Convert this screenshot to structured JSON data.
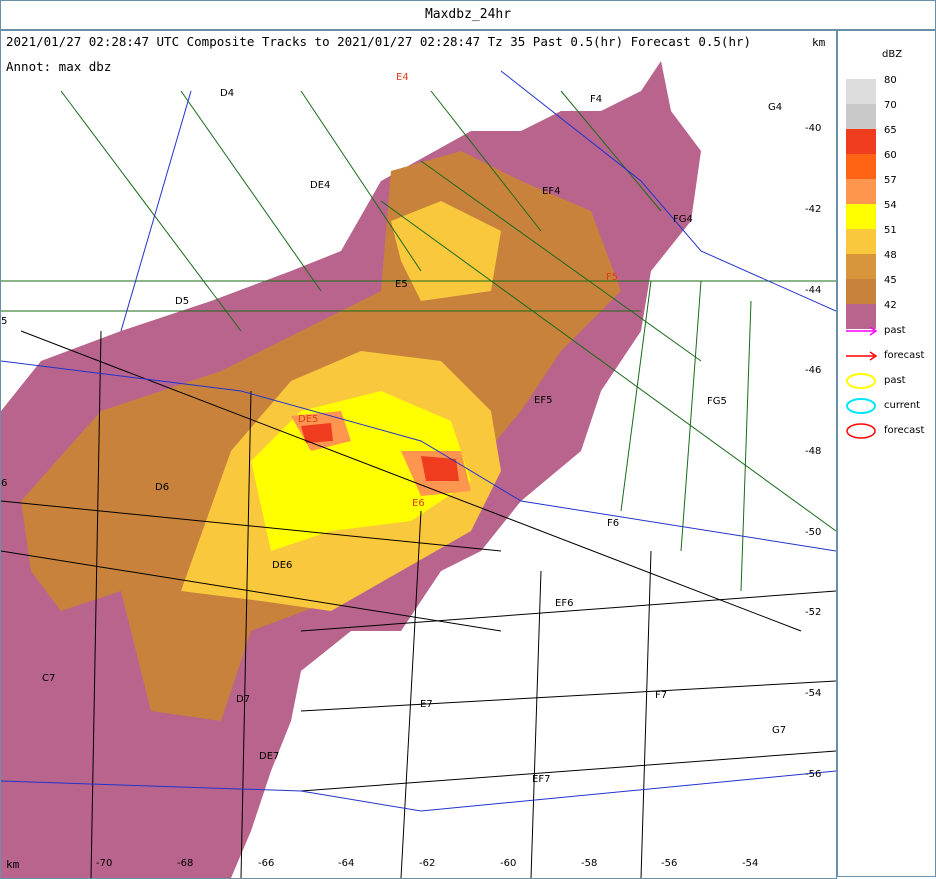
{
  "window": {
    "title": "Maxdbz_24hr"
  },
  "header": {
    "text": "2021/01/27 02:28:47 UTC Composite Tracks to 2021/01/27 02:28:47 Tz 35 Past 0.5(hr) Forecast 0.5(hr)",
    "unit_right": "km",
    "annot": "Annot: max dbz",
    "unit_bottom": "km"
  },
  "axes": {
    "x_ticks": [
      "-70",
      "-68",
      "-66",
      "-64",
      "-62",
      "-60",
      "-58",
      "-56",
      "-54"
    ],
    "y_ticks": [
      "-40",
      "-42",
      "-44",
      "-46",
      "-48",
      "-50",
      "-52",
      "-54",
      "-56"
    ]
  },
  "places": [
    {
      "label": "E4",
      "color": "red"
    },
    {
      "label": "D4",
      "color": "black"
    },
    {
      "label": "F4",
      "color": "black"
    },
    {
      "label": "G4",
      "color": "black"
    },
    {
      "label": "DE4",
      "color": "black"
    },
    {
      "label": "EF4",
      "color": "black"
    },
    {
      "label": "FG4",
      "color": "black"
    },
    {
      "label": "D5",
      "color": "black"
    },
    {
      "label": "E5",
      "color": "black"
    },
    {
      "label": "F5",
      "color": "red"
    },
    {
      "label": "EF5",
      "color": "black"
    },
    {
      "label": "FG5",
      "color": "black"
    },
    {
      "label": "DE5",
      "color": "red"
    },
    {
      "label": "D6",
      "color": "black"
    },
    {
      "label": "E6",
      "color": "red"
    },
    {
      "label": "F6",
      "color": "black"
    },
    {
      "label": "DE6",
      "color": "black"
    },
    {
      "label": "EF6",
      "color": "black"
    },
    {
      "label": "C7",
      "color": "black"
    },
    {
      "label": "D7",
      "color": "black"
    },
    {
      "label": "E7",
      "color": "black"
    },
    {
      "label": "F7",
      "color": "black"
    },
    {
      "label": "G7",
      "color": "black"
    },
    {
      "label": "DE7",
      "color": "black"
    },
    {
      "label": "EF7",
      "color": "black"
    },
    {
      "label": "5",
      "color": "black"
    },
    {
      "label": "6",
      "color": "black"
    }
  ],
  "legend": {
    "unit": "dBZ",
    "levels": [
      {
        "label": "80",
        "color": "#dcdcdc"
      },
      {
        "label": "70",
        "color": "#c8c8c8"
      },
      {
        "label": "65",
        "color": "#f03c1e"
      },
      {
        "label": "60",
        "color": "#ff6414"
      },
      {
        "label": "57",
        "color": "#ff9650"
      },
      {
        "label": "54",
        "color": "#ffff00"
      },
      {
        "label": "51",
        "color": "#fac83c"
      },
      {
        "label": "48",
        "color": "#d7963c"
      },
      {
        "label": "45",
        "color": "#c8823c"
      },
      {
        "label": "42",
        "color": "#b9648c"
      }
    ],
    "keys": [
      {
        "label": "past",
        "kind": "arrow",
        "color": "#ff00ff"
      },
      {
        "label": "forecast",
        "kind": "arrow",
        "color": "#ff0000"
      },
      {
        "label": "past",
        "kind": "ellipse",
        "color": "#ffff00"
      },
      {
        "label": "current",
        "kind": "ellipse",
        "color": "#00e5ff"
      },
      {
        "label": "forecast",
        "kind": "ellipse",
        "color": "#ff0000"
      }
    ]
  }
}
